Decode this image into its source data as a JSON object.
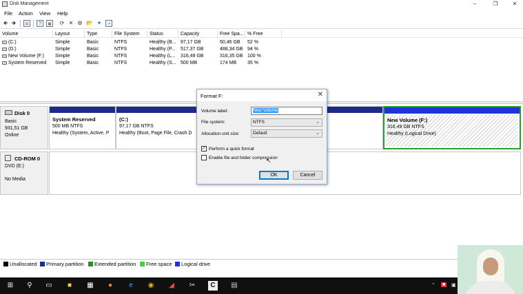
{
  "window": {
    "title": "Disk Management",
    "minimize_icon": "minimize-icon",
    "maximize_icon": "maximize-icon",
    "close_icon": "close-icon"
  },
  "menu": [
    "File",
    "Action",
    "View",
    "Help"
  ],
  "toolbar": {
    "icons": [
      "back-icon",
      "forward-icon",
      "list-icon",
      "help-icon",
      "properties-icon",
      "refresh-icon",
      "delete-icon",
      "settings-icon",
      "open-icon",
      "wizard-icon",
      "export-icon"
    ]
  },
  "volume_list": {
    "columns": [
      "Volume",
      "Layout",
      "Type",
      "File System",
      "Status",
      "Capacity",
      "Free Spa...",
      "% Free"
    ],
    "rows": [
      {
        "volume": "(C:)",
        "layout": "Simple",
        "type": "Basic",
        "fs": "NTFS",
        "status": "Healthy (B...",
        "capacity": "97,17 GB",
        "free": "50,46 GB",
        "pct": "52 %"
      },
      {
        "volume": "(D:)",
        "layout": "Simple",
        "type": "Basic",
        "fs": "NTFS",
        "status": "Healthy (P...",
        "capacity": "517,37 GB",
        "free": "488,34 GB",
        "pct": "94 %"
      },
      {
        "volume": "New Volume (F:)",
        "layout": "Simple",
        "type": "Basic",
        "fs": "NTFS",
        "status": "Healthy (L...",
        "capacity": "316,49 GB",
        "free": "316,35 GB",
        "pct": "100 %"
      },
      {
        "volume": "System Reserved",
        "layout": "Simple",
        "type": "Basic",
        "fs": "NTFS",
        "status": "Healthy (S...",
        "capacity": "500 MB",
        "free": "174 MB",
        "pct": "35 %"
      }
    ]
  },
  "disks": [
    {
      "name": "Disk 0",
      "type": "Basic",
      "size": "931,51 GB",
      "state": "Online",
      "partitions": [
        {
          "title": "System Reserved",
          "size": "500 MB NTFS",
          "status": "Healthy (System, Active, P"
        },
        {
          "title": "(C:)",
          "size": "97,17 GB NTFS",
          "status": "Healthy (Boot, Page File, Crash D"
        },
        {
          "title": "New Volume  (F:)",
          "size": "316,49 GB NTFS",
          "status": "Healthy (Logical Drive)"
        }
      ]
    },
    {
      "name": "CD-ROM 0",
      "type": "DVD (E:)",
      "state": "No Media"
    }
  ],
  "legend": {
    "items": [
      {
        "label": "Unallocated",
        "color": "#000000"
      },
      {
        "label": "Primary partition",
        "color": "#1e2a8c"
      },
      {
        "label": "Extended partition",
        "color": "#2e8b2e"
      },
      {
        "label": "Free space",
        "color": "#33dd33"
      },
      {
        "label": "Logical drive",
        "color": "#2233dd"
      }
    ]
  },
  "dialog": {
    "title": "Format F:",
    "volume_label_label": "Volume label:",
    "volume_label_value": "New Volume",
    "file_system_label": "File system:",
    "file_system_value": "NTFS",
    "allocation_label": "Allocation unit size:",
    "allocation_value": "Default",
    "quick_format_label": "Perform a quick format",
    "quick_format_checked": true,
    "compression_label": "Enable file and folder compression",
    "compression_checked": false,
    "ok_label": "OK",
    "cancel_label": "Cancel"
  },
  "taskbar": {
    "icons": [
      "start-icon",
      "search-icon",
      "task-view-icon",
      "file-explorer-icon",
      "store-icon",
      "firefox-icon",
      "edge-icon",
      "chrome-icon",
      "paint-icon",
      "snipping-icon",
      "camtasia-icon",
      "disk-management-icon"
    ]
  }
}
